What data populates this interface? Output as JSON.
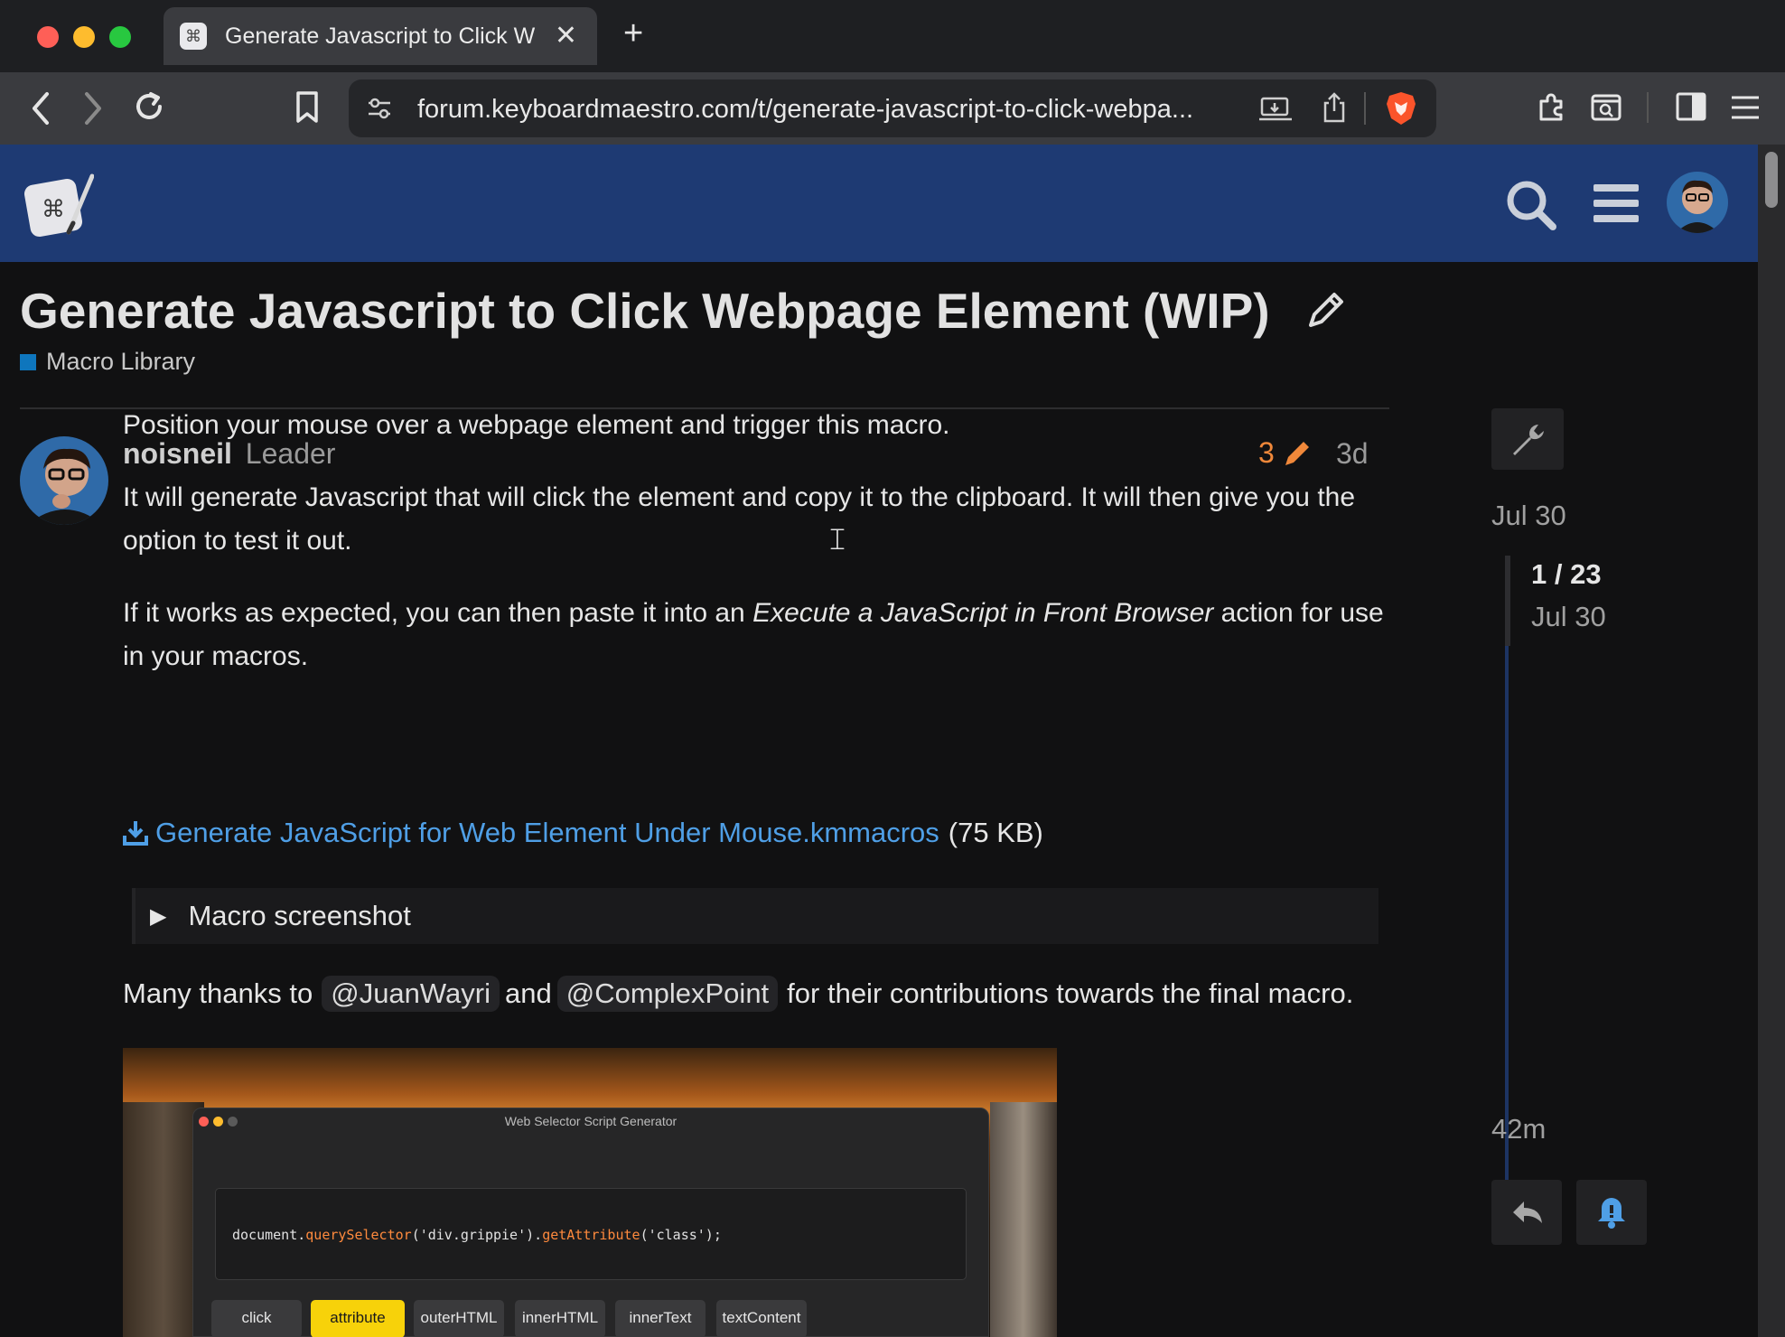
{
  "browser": {
    "tab_title": "Generate Javascript to Click W",
    "url": "forum.keyboardmaestro.com/t/generate-javascript-to-click-webpa..."
  },
  "topic": {
    "title": "Generate Javascript to Click Webpage Element (WIP)",
    "category": "Macro Library",
    "category_color": "#0e76bd"
  },
  "post": {
    "username": "noisneil",
    "user_title": "Leader",
    "edit_count": "3",
    "age": "3d",
    "p1": "Position your mouse over a webpage element and trigger this macro.",
    "p2": "It will generate Javascript that will click the element and copy it to the clipboard. It will then give you the option to test it out.",
    "p3_before": "If it works as expected, you can then paste it into an ",
    "p3_em": "Execute a JavaScript in Front Browser",
    "p3_after": " action for use in your macros.",
    "attachment_name": "Generate JavaScript for Web Element Under Mouse.kmmacros",
    "attachment_size": "(75 KB)",
    "details_summary": "Macro screenshot",
    "thanks_before": "Many thanks to",
    "mention1": "@JuanWayri",
    "thanks_and": "and",
    "mention2": "@ComplexPoint",
    "thanks_after": "for their contributions towards the final macro."
  },
  "image": {
    "window_title": "Web Selector Script Generator",
    "code_prefix": "document.",
    "code_fn1": "querySelector",
    "code_mid": "('div.grippie').",
    "code_fn2": "getAttribute",
    "code_suffix": "('class');",
    "buttons": [
      "click",
      "attribute",
      "outerHTML",
      "innerHTML",
      "innerText",
      "textContent"
    ],
    "active_button": "attribute"
  },
  "timeline": {
    "top_date": "Jul 30",
    "position": "1 / 23",
    "current_date": "Jul 30",
    "bottom_label": "42m"
  },
  "colors": {
    "header_bg": "#1e3a73",
    "link": "#4f9fe6",
    "edit_accent": "#f0883a"
  }
}
